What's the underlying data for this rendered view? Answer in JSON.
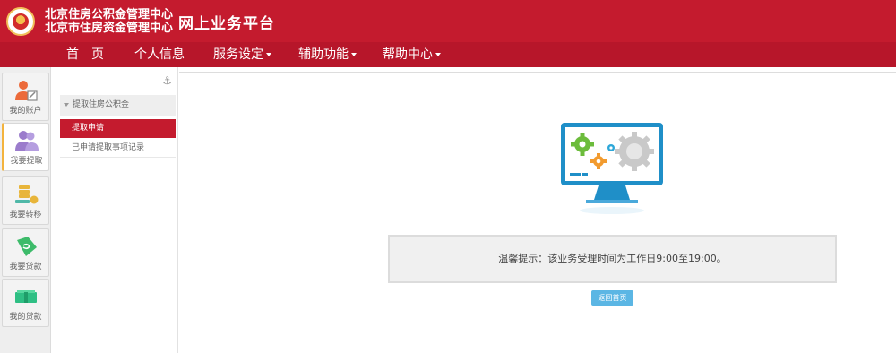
{
  "header": {
    "org_name_1": "北京住房公积金管理中心",
    "org_name_2": "北京市住房资金管理中心",
    "platform_title": "网上业务平台"
  },
  "nav": {
    "items": [
      {
        "label": "首　页",
        "dropdown": false
      },
      {
        "label": "个人信息",
        "dropdown": false
      },
      {
        "label": "服务设定",
        "dropdown": true
      },
      {
        "label": "辅助功能",
        "dropdown": true
      },
      {
        "label": "帮助中心",
        "dropdown": true
      }
    ]
  },
  "rail": {
    "items": [
      {
        "label": "我的账户",
        "icon": "account-icon"
      },
      {
        "label": "我要提取",
        "icon": "withdraw-icon",
        "active": true
      },
      {
        "label": "我要转移",
        "icon": "transfer-icon"
      },
      {
        "label": "我要贷款",
        "icon": "loan-icon"
      },
      {
        "label": "我的贷款",
        "icon": "my-loan-icon"
      }
    ]
  },
  "submenu": {
    "group_label": "提取住房公积金",
    "items": [
      {
        "label": "提取申请",
        "active": true
      },
      {
        "label": "已申请提取事项记录",
        "active": false
      }
    ]
  },
  "main": {
    "notice": "温馨提示：该业务受理时间为工作日9:00至19:00。",
    "back_button": "返回首页"
  },
  "colors": {
    "brand_red": "#c41b2e",
    "nav_red": "#b7162a",
    "button_blue": "#5bb6e4",
    "active_border": "#f3b33d"
  }
}
